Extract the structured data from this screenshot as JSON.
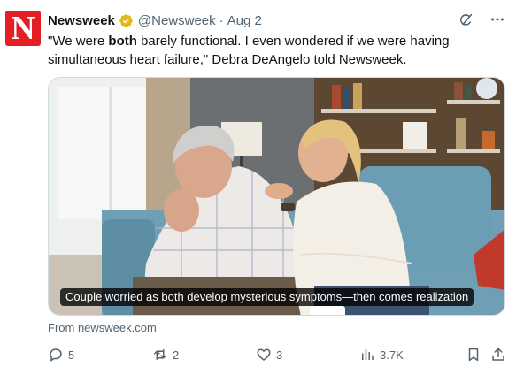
{
  "author": {
    "avatar_letter": "N",
    "name": "Newsweek",
    "handle": "@Newsweek",
    "separator": "·",
    "date": "Aug 2",
    "brand_color": "#e31e24",
    "verified_color": "#e2b719"
  },
  "header_icons": [
    "grok-icon",
    "more-icon"
  ],
  "tweet": {
    "text_part1": "\"We were ",
    "text_bold": "both",
    "text_part2": " barely functional. I even wondered if we were having simultaneous heart failure,\" Debra DeAngelo told Newsweek."
  },
  "media": {
    "caption": "Couple worried as both develop mysterious symptoms—then comes realization"
  },
  "source": "From newsweek.com",
  "actions": {
    "replies": "5",
    "reposts": "2",
    "likes": "3",
    "views": "3.7K"
  }
}
